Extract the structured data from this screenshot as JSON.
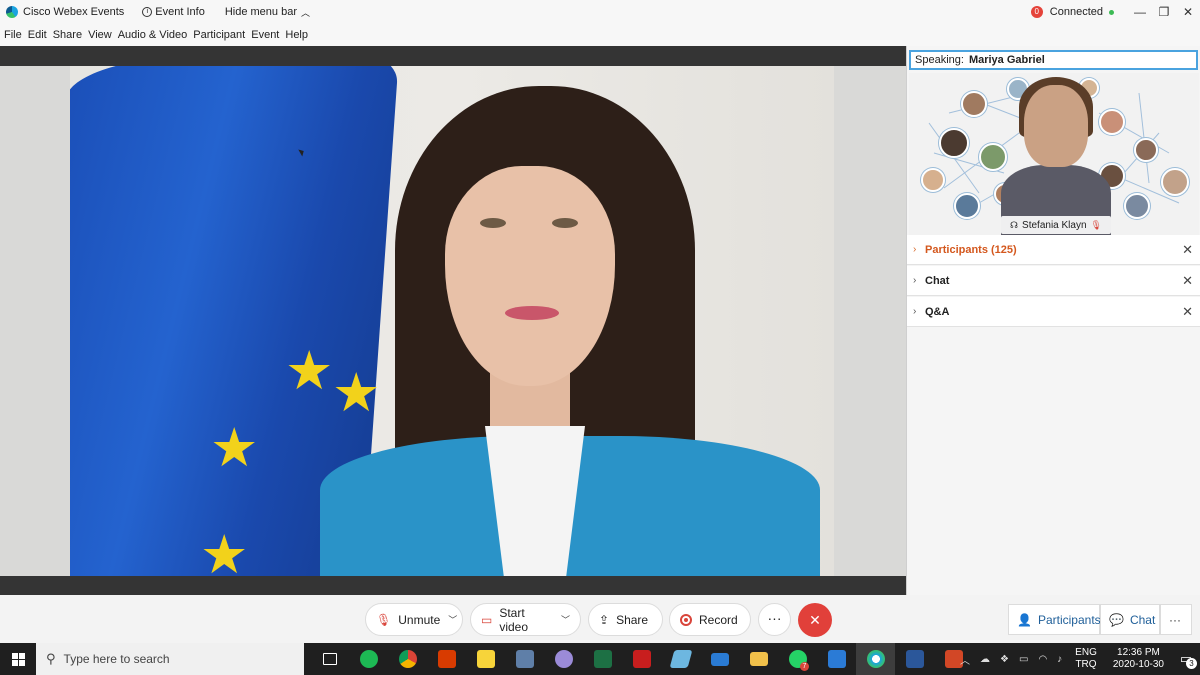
{
  "titlebar": {
    "app_name": "Cisco Webex Events",
    "event_info": "Event Info",
    "hide_menu": "Hide menu bar",
    "connected": "Connected"
  },
  "menu": [
    "File",
    "Edit",
    "Share",
    "View",
    "Audio & Video",
    "Participant",
    "Event",
    "Help"
  ],
  "panel": {
    "speaking_label": "Speaking:",
    "speaker": "Mariya Gabriel",
    "thumb_name": "Stefania Klayn",
    "sections": [
      {
        "label": "Participants (125)"
      },
      {
        "label": "Chat"
      },
      {
        "label": "Q&A"
      }
    ]
  },
  "controls": {
    "unmute": "Unmute",
    "start_video": "Start video",
    "share": "Share",
    "record": "Record",
    "participants": "Participants",
    "chat": "Chat"
  },
  "taskbar": {
    "search_placeholder": "Type here to search",
    "lang_top": "ENG",
    "lang_bottom": "TRQ",
    "time": "12:36 PM",
    "date": "2020-10-30",
    "notifications": "3",
    "whatsapp_badge": "7"
  },
  "colors": {
    "accent_blue": "#4aa3df",
    "leave_red": "#e1403a",
    "participants_orange": "#d4581e"
  }
}
